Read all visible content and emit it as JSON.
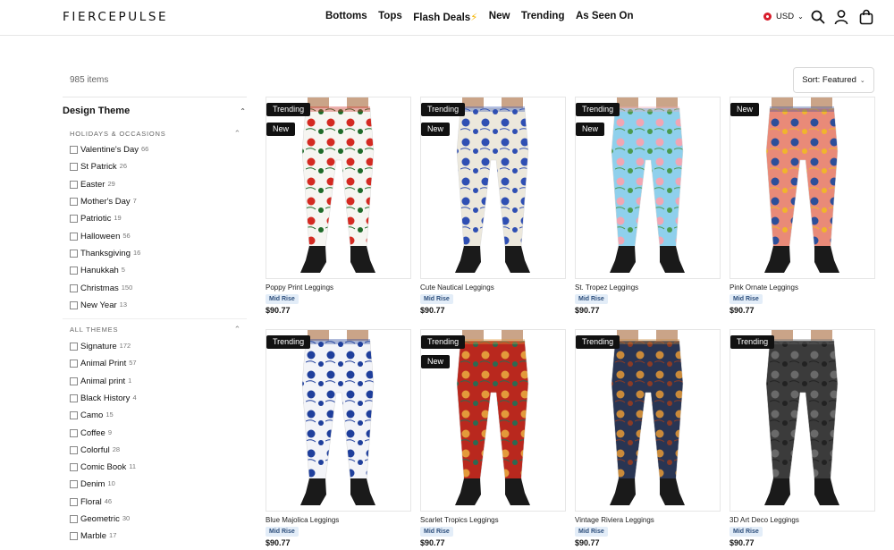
{
  "header": {
    "logo": "FIERCEPULSE",
    "nav": [
      {
        "label": "Bottoms"
      },
      {
        "label": "Tops"
      },
      {
        "label": "Flash Deals",
        "icon": "⚡"
      },
      {
        "label": "New"
      },
      {
        "label": "Trending"
      },
      {
        "label": "As Seen On"
      }
    ],
    "currency": "USD",
    "icons": [
      "search-icon",
      "account-icon",
      "cart-icon"
    ]
  },
  "results": {
    "count": "985 items"
  },
  "sort": {
    "label": "Sort: Featured"
  },
  "sidebar": {
    "title": "Design Theme",
    "groups": [
      {
        "title": "HOLIDAYS & OCCASIONS",
        "items": [
          {
            "label": "Valentine's Day",
            "count": "66"
          },
          {
            "label": "St Patrick",
            "count": "26"
          },
          {
            "label": "Easter",
            "count": "29"
          },
          {
            "label": "Mother's Day",
            "count": "7"
          },
          {
            "label": "Patriotic",
            "count": "19"
          },
          {
            "label": "Halloween",
            "count": "56"
          },
          {
            "label": "Thanksgiving",
            "count": "16"
          },
          {
            "label": "Hanukkah",
            "count": "5"
          },
          {
            "label": "Christmas",
            "count": "150"
          },
          {
            "label": "New Year",
            "count": "13"
          }
        ]
      },
      {
        "title": "ALL THEMES",
        "items": [
          {
            "label": "Signature",
            "count": "172"
          },
          {
            "label": "Animal Print",
            "count": "57"
          },
          {
            "label": "Animal print",
            "count": "1"
          },
          {
            "label": "Black History",
            "count": "4"
          },
          {
            "label": "Camo",
            "count": "15"
          },
          {
            "label": "Coffee",
            "count": "9"
          },
          {
            "label": "Colorful",
            "count": "28"
          },
          {
            "label": "Comic Book",
            "count": "11"
          },
          {
            "label": "Denim",
            "count": "10"
          },
          {
            "label": "Floral",
            "count": "46"
          },
          {
            "label": "Geometric",
            "count": "30"
          },
          {
            "label": "Marble",
            "count": "17"
          }
        ]
      }
    ]
  },
  "products": [
    {
      "name": "Poppy Print Leggings",
      "rise": "Mid Rise",
      "price": "$90.77",
      "badges": [
        "Trending",
        "New"
      ],
      "colors": {
        "base": "#f6f5f1",
        "accent": "#d42a22",
        "accent2": "#1f6b2a"
      }
    },
    {
      "name": "Cute Nautical Leggings",
      "rise": "Mid Rise",
      "price": "$90.77",
      "badges": [
        "Trending",
        "New"
      ],
      "colors": {
        "base": "#ece8dc",
        "accent": "#2f4fb3",
        "accent2": "#2f4fb3"
      }
    },
    {
      "name": "St. Tropez Leggings",
      "rise": "Mid Rise",
      "price": "$90.77",
      "badges": [
        "Trending",
        "New"
      ],
      "colors": {
        "base": "#8fd0ec",
        "accent": "#f0a6b4",
        "accent2": "#4a9b4f"
      }
    },
    {
      "name": "Pink Ornate Leggings",
      "rise": "Mid Rise",
      "price": "$90.77",
      "badges": [
        "New"
      ],
      "colors": {
        "base": "#e98a78",
        "accent": "#2d4f9a",
        "accent2": "#f0b52c"
      }
    },
    {
      "name": "Blue Majolica Leggings",
      "rise": "Mid Rise",
      "price": "$90.77",
      "badges": [
        "Trending"
      ],
      "colors": {
        "base": "#f3f4f8",
        "accent": "#1f3f9c",
        "accent2": "#1f3f9c"
      }
    },
    {
      "name": "Scarlet Tropics Leggings",
      "rise": "Mid Rise",
      "price": "$90.77",
      "badges": [
        "Trending",
        "New"
      ],
      "colors": {
        "base": "#b9281e",
        "accent": "#e39a3a",
        "accent2": "#2c6a52"
      }
    },
    {
      "name": "Vintage Riviera Leggings",
      "rise": "Mid Rise",
      "price": "$90.77",
      "badges": [
        "Trending"
      ],
      "colors": {
        "base": "#293553",
        "accent": "#c98a3a",
        "accent2": "#8a3b25"
      }
    },
    {
      "name": "3D Art Deco Leggings",
      "rise": "Mid Rise",
      "price": "$90.77",
      "badges": [
        "Trending"
      ],
      "colors": {
        "base": "#3b3b3b",
        "accent": "#6a6a6a",
        "accent2": "#222222"
      }
    }
  ]
}
